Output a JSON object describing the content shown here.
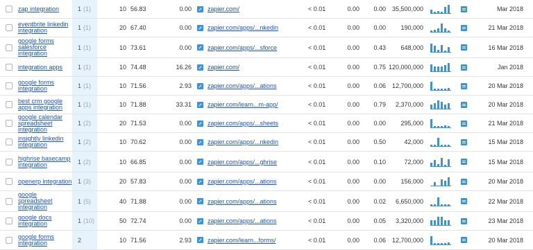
{
  "rows": [
    {
      "keyword": "zap integration",
      "position": "1",
      "previous": "(1)",
      "volume": "10",
      "kd": "56.83",
      "cpc": "0.00",
      "url": "zapier.com/",
      "competition": "< 0.01",
      "results": "0.00",
      "traffic": "0.00",
      "cost": "35,500,000",
      "trend": [
        3,
        1,
        2,
        1,
        5,
        7
      ],
      "date": "Mar 2018"
    },
    {
      "keyword": "eventbrite linkedin integration",
      "position": "1",
      "previous": "(1)",
      "volume": "20",
      "kd": "67.40",
      "cpc": "0.00",
      "url": "zapier.com/apps/...nkedin",
      "competition": "< 0.01",
      "results": "0.00",
      "traffic": "0.00",
      "cost": "190,000",
      "trend": [
        1,
        2,
        3,
        7,
        3,
        1
      ],
      "date": "21 Mar 2018"
    },
    {
      "keyword": "google forms salesforce integration",
      "position": "1",
      "previous": "(1)",
      "volume": "10",
      "kd": "73.61",
      "cpc": "0.00",
      "url": "zapier.com/apps/...sforce",
      "competition": "< 0.01",
      "results": "0.00",
      "traffic": "0.43",
      "cost": "648,000",
      "trend": [
        7,
        5,
        2,
        6,
        1,
        4
      ],
      "date": "16 Mar 2018"
    },
    {
      "keyword": "integration apps",
      "position": "1",
      "previous": "(1)",
      "volume": "10",
      "kd": "74.48",
      "cpc": "16.26",
      "url": "zapier.com/",
      "competition": "< 0.01",
      "results": "0.00",
      "traffic": "0.75",
      "cost": "120,000,000",
      "trend": [
        6,
        4,
        4,
        4,
        5,
        7
      ],
      "date": "Jan 2018"
    },
    {
      "keyword": "google forms integration",
      "position": "1",
      "previous": "(1)",
      "volume": "10",
      "kd": "71.56",
      "cpc": "2.93",
      "url": "zapier.com/apps/...ations",
      "competition": "< 0.01",
      "results": "0.00",
      "traffic": "0.06",
      "cost": "12,700,000",
      "trend": [
        7,
        1,
        1,
        1,
        1,
        2
      ],
      "date": "20 Mar 2018"
    },
    {
      "keyword": "best crm google apps integration",
      "position": "1",
      "previous": "(1)",
      "volume": "10",
      "kd": "71.88",
      "cpc": "33.31",
      "url": "zapier.com/learn...m-app/",
      "competition": "< 0.01",
      "results": "0.00",
      "traffic": "0.79",
      "cost": "2,370,000",
      "trend": [
        3,
        4,
        6,
        5,
        3,
        4
      ],
      "date": "20 Mar 2018"
    },
    {
      "keyword": "google calendar spreadsheet integration",
      "position": "1",
      "previous": "(2)",
      "volume": "20",
      "kd": "71.53",
      "cpc": "0.00",
      "url": "zapier.com/apps/...sheets",
      "competition": "< 0.01",
      "results": "0.00",
      "traffic": "0.00",
      "cost": "295,000",
      "trend": [
        7,
        1,
        1,
        1,
        2,
        1
      ],
      "date": "21 Mar 2018"
    },
    {
      "keyword": "insightly linkedin integration",
      "position": "1",
      "previous": "(2)",
      "volume": "10",
      "kd": "70.62",
      "cpc": "0.00",
      "url": "zapier.com/apps/...nkedin",
      "competition": "< 0.01",
      "results": "0.00",
      "traffic": "0.50",
      "cost": "42,000",
      "trend": [
        1,
        1,
        7,
        1,
        1,
        1
      ],
      "date": "15 Mar 2018"
    },
    {
      "keyword": "highrise basecamp integration",
      "position": "1",
      "previous": "(2)",
      "volume": "10",
      "kd": "66.85",
      "cpc": "0.00",
      "url": "zapier.com/apps/...ghrise",
      "competition": "< 0.01",
      "results": "0.00",
      "traffic": "0.10",
      "cost": "72,000",
      "trend": [
        3,
        5,
        2,
        7,
        1,
        6
      ],
      "date": "15 Mar 2018"
    },
    {
      "keyword": "openerp integration",
      "position": "1",
      "previous": "(3)",
      "volume": "20",
      "kd": "57.83",
      "cpc": "0.00",
      "url": "zapier.com/apps/...ations",
      "competition": "< 0.01",
      "results": "0.00",
      "traffic": "0.00",
      "cost": "156,000",
      "trend": [
        0,
        3,
        0,
        5,
        4,
        7
      ],
      "date": "20 Mar 2018"
    },
    {
      "keyword": "google spreadsheet integration",
      "position": "1",
      "previous": "(5)",
      "volume": "40",
      "kd": "71.88",
      "cpc": "0.00",
      "url": "zapier.com/apps/...ations",
      "competition": "< 0.01",
      "results": "0.00",
      "traffic": "0.02",
      "cost": "6,650,000",
      "trend": [
        1,
        1,
        7,
        1,
        1,
        1
      ],
      "date": "22 Mar 2018"
    },
    {
      "keyword": "google docs integration",
      "position": "1",
      "previous": "(10)",
      "volume": "50",
      "kd": "72.74",
      "cpc": "0.00",
      "url": "zapier.com/apps/...ations",
      "competition": "< 0.01",
      "results": "0.00",
      "traffic": "0.05",
      "cost": "3,320,000",
      "trend": [
        4,
        4,
        7,
        7,
        4,
        4
      ],
      "date": "23 Mar 2018"
    },
    {
      "keyword": "google forms integration",
      "position": "2",
      "previous": "",
      "volume": "10",
      "kd": "71.56",
      "cpc": "2.93",
      "url": "zapier.com/learn...forms/",
      "competition": "< 0.01",
      "results": "0.00",
      "traffic": "0.06",
      "cost": "12,700,000",
      "trend": [
        7,
        1,
        1,
        1,
        1,
        2
      ],
      "date": "20 Mar 2018"
    }
  ],
  "icons": {
    "url_icon": "external-link-icon",
    "serp_icon": "serp-snapshot-icon",
    "row_select": "checkbox"
  },
  "colors": {
    "link": "#1a53c5",
    "position_column_bg": "#e6f2fc",
    "trend_bar": "#3d93d9",
    "row_border": "#e3e3e3"
  }
}
